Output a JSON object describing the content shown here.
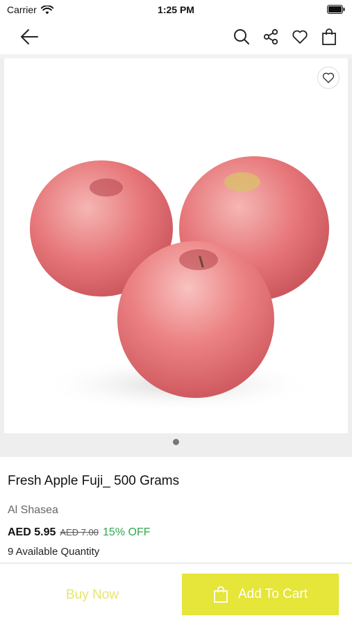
{
  "status_bar": {
    "carrier": "Carrier",
    "time": "1:25 PM"
  },
  "nav": {
    "icons": [
      "back-arrow-icon",
      "search-icon",
      "share-icon",
      "heart-icon",
      "shopping-bag-icon"
    ]
  },
  "gallery": {
    "image_subject": "three red Fuji apples",
    "page_count": 1,
    "current_page": 1
  },
  "product": {
    "title": "Fresh Apple Fuji_ 500 Grams",
    "brand": "Al Shasea",
    "price": "AED 5.95",
    "old_price": "AED 7.00",
    "discount": "15% OFF",
    "available": "9 Available Quantity"
  },
  "actions": {
    "buy_now_label": "Buy Now",
    "add_to_cart_label": "Add To Cart"
  },
  "colors": {
    "accent_yellow": "#e5e53a",
    "discount_green": "#2fa84f"
  }
}
